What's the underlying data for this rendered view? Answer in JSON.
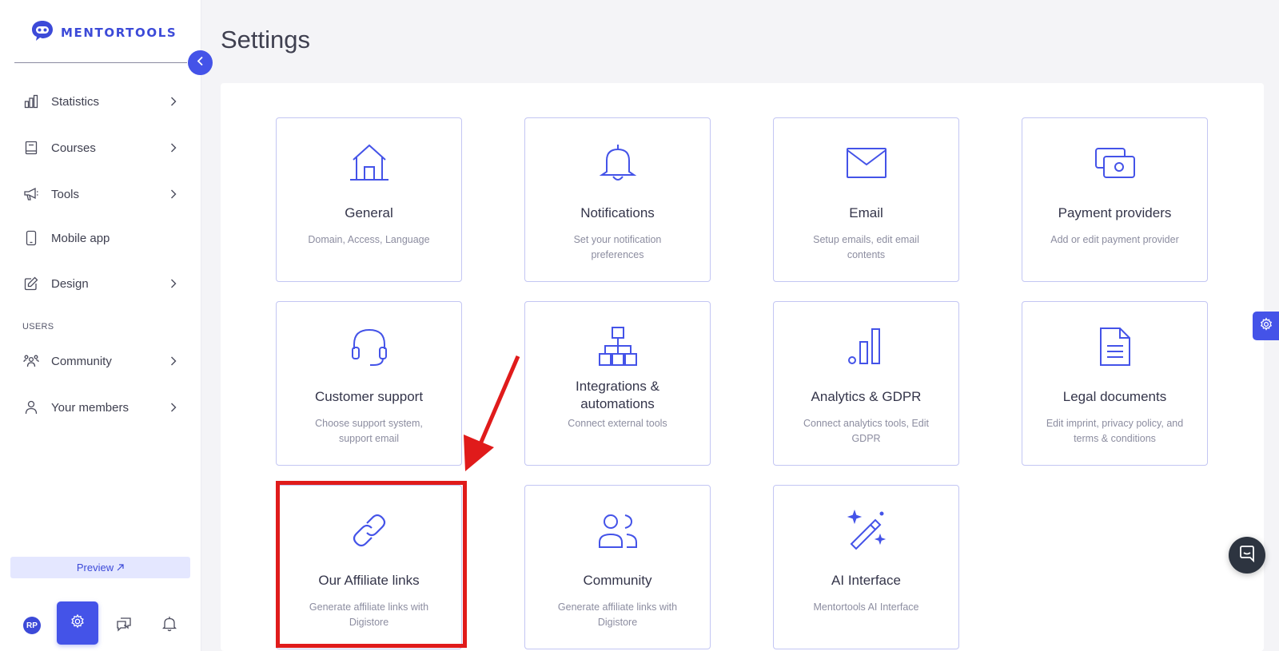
{
  "brand": {
    "name": "MENTORTOOLS"
  },
  "sidebar": {
    "items": [
      {
        "label": "Statistics",
        "icon": "bar-chart-icon",
        "has_chevron": true
      },
      {
        "label": "Courses",
        "icon": "book-icon",
        "has_chevron": true
      },
      {
        "label": "Tools",
        "icon": "megaphone-icon",
        "has_chevron": true
      },
      {
        "label": "Mobile app",
        "icon": "phone-icon",
        "has_chevron": false
      },
      {
        "label": "Design",
        "icon": "pencil-icon",
        "has_chevron": true
      }
    ],
    "users_section_label": "USERS",
    "user_items": [
      {
        "label": "Community",
        "icon": "people-icon",
        "has_chevron": true
      },
      {
        "label": "Your members",
        "icon": "user-icon",
        "has_chevron": true
      }
    ],
    "preview_label": "Preview",
    "avatar_initials": "RP"
  },
  "page": {
    "title": "Settings"
  },
  "cards": [
    {
      "title": "General",
      "desc": "Domain, Access, Language",
      "icon": "home-icon"
    },
    {
      "title": "Notifications",
      "desc": "Set your notification preferences",
      "icon": "bell-icon"
    },
    {
      "title": "Email",
      "desc": "Setup emails, edit email contents",
      "icon": "envelope-icon"
    },
    {
      "title": "Payment providers",
      "desc": "Add or edit payment provider",
      "icon": "money-icon"
    },
    {
      "title": "Customer support",
      "desc": "Choose support system, support email",
      "icon": "headset-icon"
    },
    {
      "title": "Integrations & automations",
      "desc": "Connect external tools",
      "icon": "network-icon"
    },
    {
      "title": "Analytics & GDPR",
      "desc": "Connect analytics tools, Edit GDPR",
      "icon": "analytics-icon"
    },
    {
      "title": "Legal documents",
      "desc": "Edit imprint, privacy policy, and terms & conditions",
      "icon": "document-icon"
    },
    {
      "title": "Our Affiliate links",
      "desc": "Generate affiliate links with Digistore",
      "icon": "link-icon"
    },
    {
      "title": "Community",
      "desc": "Generate affiliate links with Digistore",
      "icon": "people-icon"
    },
    {
      "title": "AI Interface",
      "desc": "Mentortools AI Interface",
      "icon": "magic-wand-icon"
    }
  ],
  "colors": {
    "accent": "#4453e8",
    "card_border": "#c3c6f3",
    "highlight": "#e01b1b",
    "background": "#f4f4f7"
  }
}
